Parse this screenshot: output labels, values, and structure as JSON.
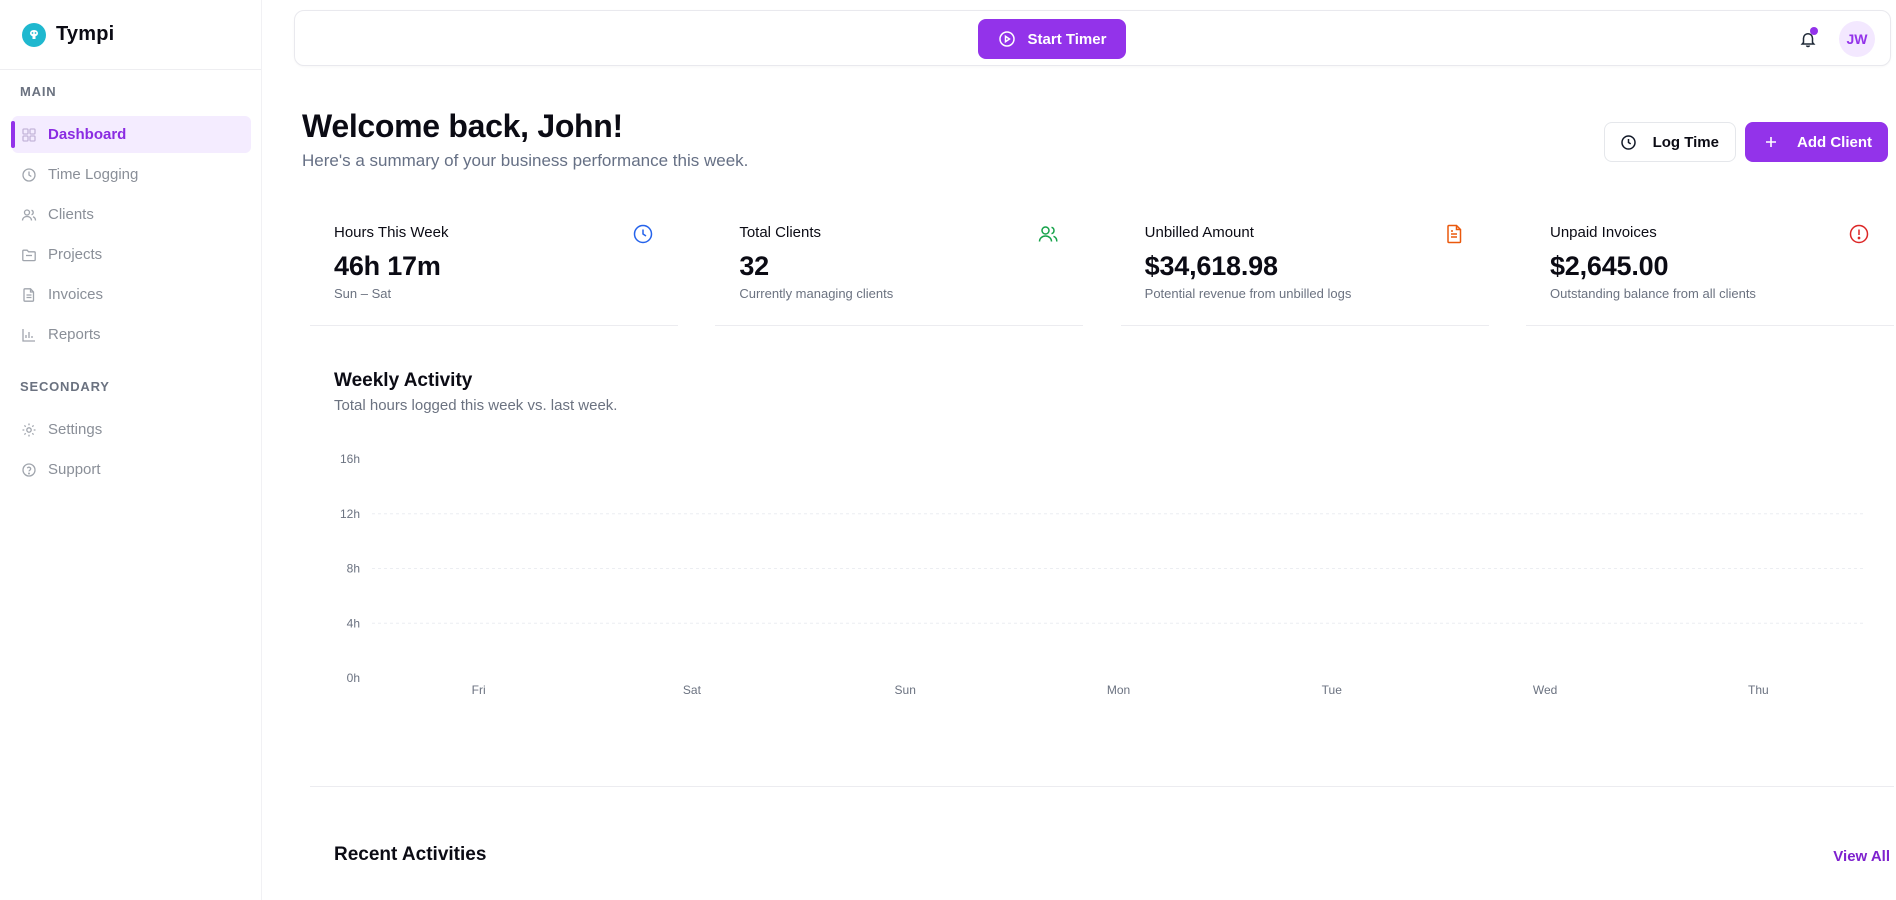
{
  "app": {
    "name": "Tympi"
  },
  "sidebar": {
    "sections": [
      {
        "title": "MAIN"
      },
      {
        "title": "SECONDARY"
      }
    ],
    "main_items": [
      {
        "label": "Dashboard",
        "icon": "grid-icon",
        "active": true
      },
      {
        "label": "Time Logging",
        "icon": "clock-icon"
      },
      {
        "label": "Clients",
        "icon": "users-icon"
      },
      {
        "label": "Projects",
        "icon": "folder-icon"
      },
      {
        "label": "Invoices",
        "icon": "document-icon"
      },
      {
        "label": "Reports",
        "icon": "bar-chart-icon"
      }
    ],
    "secondary_items": [
      {
        "label": "Settings",
        "icon": "gear-icon"
      },
      {
        "label": "Support",
        "icon": "help-circle-icon"
      }
    ]
  },
  "topbar": {
    "start_timer_label": "Start Timer",
    "avatar_initials": "JW",
    "notification_unread": true
  },
  "header": {
    "title": "Welcome back, John!",
    "subtitle": "Here's a summary of your business performance this week.",
    "log_time_label": "Log Time",
    "add_client_label": "Add Client"
  },
  "stats": [
    {
      "title": "Hours This Week",
      "value": "46h 17m",
      "sub": "Sun – Sat",
      "icon": "clock-icon",
      "color": "#2563eb"
    },
    {
      "title": "Total Clients",
      "value": "32",
      "sub": "Currently managing clients",
      "icon": "users-icon",
      "color": "#16a34a"
    },
    {
      "title": "Unbilled Amount",
      "value": "$34,618.98",
      "sub": "Potential revenue from unbilled logs",
      "icon": "document-icon",
      "color": "#ea580c"
    },
    {
      "title": "Unpaid Invoices",
      "value": "$2,645.00",
      "sub": "Outstanding balance from all clients",
      "icon": "alert-circle-icon",
      "color": "#dc2626"
    }
  ],
  "activity": {
    "title": "Weekly Activity",
    "subtitle": "Total hours logged this week vs. last week."
  },
  "chart_data": {
    "type": "bar",
    "categories": [
      "Fri",
      "Sat",
      "Sun",
      "Mon",
      "Tue",
      "Wed",
      "Thu"
    ],
    "series": [
      {
        "values": [
          0,
          0,
          0,
          0,
          0,
          0,
          0
        ]
      }
    ],
    "ylim": [
      0,
      16
    ],
    "yticks": [
      "0h",
      "4h",
      "8h",
      "12h",
      "16h"
    ],
    "grid": true
  },
  "recent": {
    "title": "Recent Activities",
    "view_all_label": "View All"
  },
  "colors": {
    "accent": "#9333ea",
    "accent_light": "#f4ecff",
    "brand": "#1fb8cf"
  }
}
